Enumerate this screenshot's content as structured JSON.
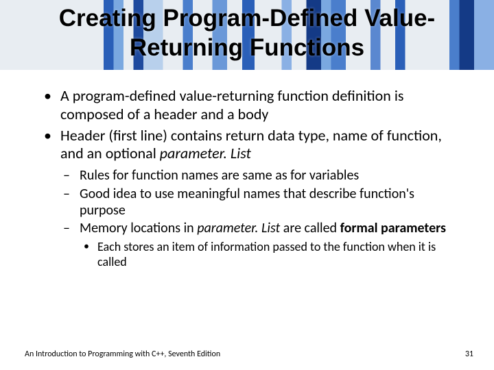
{
  "title_line1": "Creating Program-Defined Value-",
  "title_line2": "Returning Functions",
  "bullets": {
    "b1": "A program-defined value-returning function definition is composed of a header and a body",
    "b2_pre": "Header (first line) contains return data type, name of function, and an optional ",
    "b2_italic": "parameter. List",
    "sub1": "Rules for function names are same as for variables",
    "sub2": "Good idea to use meaningful names that describe function's purpose",
    "sub3_pre": "Memory locations in ",
    "sub3_italic": "parameter. List ",
    "sub3_mid": "are called ",
    "sub3_bold": "formal parameters",
    "subsub1": "Each stores an item of information passed to the function when it is called"
  },
  "footer": {
    "left": "An Introduction to Programming with C++, Seventh Edition",
    "page": "31"
  }
}
